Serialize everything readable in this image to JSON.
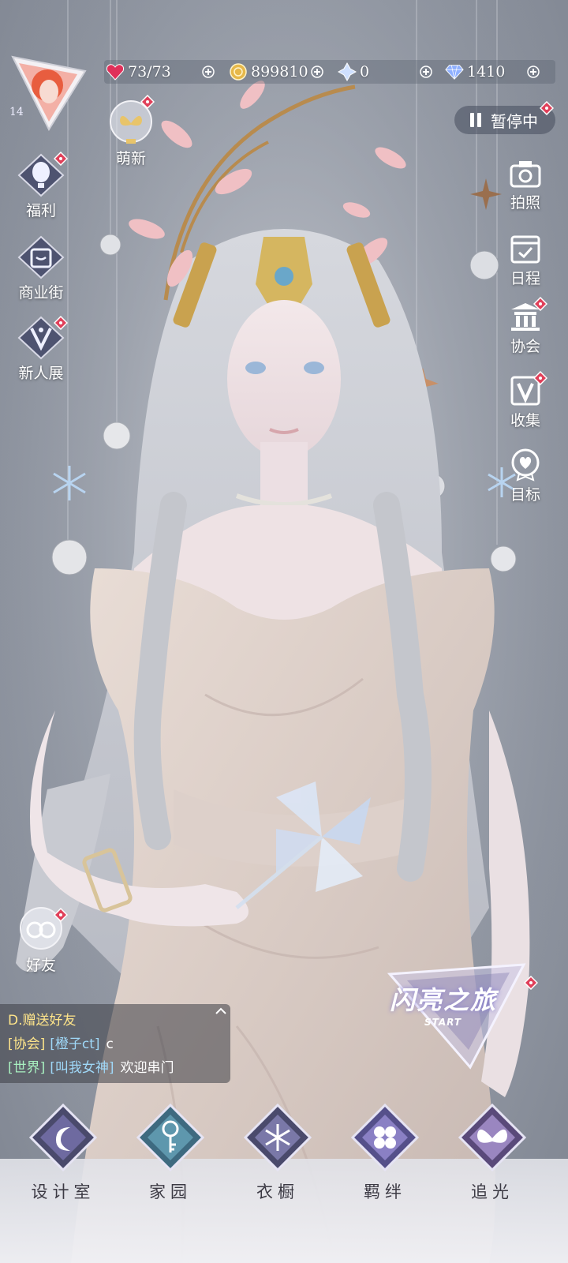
{
  "resources": [
    {
      "name": "stamina-icon",
      "value": "73/73",
      "color": "#e0305a"
    },
    {
      "name": "gold-coin-icon",
      "value": "899810",
      "color": "#e6b84a"
    },
    {
      "name": "crystal-icon",
      "value": "0",
      "color": "#cfe0ff"
    },
    {
      "name": "diamond-icon",
      "value": "1410",
      "color": "#8fb0ff"
    }
  ],
  "player": {
    "level": "14"
  },
  "left_menu": [
    {
      "label": "萌新",
      "icon": "butterfly-icon"
    },
    {
      "label": "福利",
      "icon": "balloon-icon"
    },
    {
      "label": "商业街",
      "icon": "shopping-bag-icon"
    },
    {
      "label": "新人展",
      "icon": "exhibition-icon"
    },
    {
      "label": "好友",
      "icon": "friends-icon"
    }
  ],
  "right_menu": [
    {
      "label": "拍照",
      "icon": "camera-icon"
    },
    {
      "label": "日程",
      "icon": "calendar-icon"
    },
    {
      "label": "协会",
      "icon": "guild-icon"
    },
    {
      "label": "收集",
      "icon": "collection-icon"
    },
    {
      "label": "目标",
      "icon": "goal-icon"
    }
  ],
  "pause": {
    "label": "暂停中"
  },
  "chat": [
    {
      "tag": "",
      "user": "",
      "message": "D.赠送好友"
    },
    {
      "tag": "[协会]",
      "user": "[橙子ct]",
      "message": "c"
    },
    {
      "tag": "[世界]",
      "user": "[叫我女神]",
      "message": "欢迎串门"
    }
  ],
  "journey": {
    "title": "闪亮之旅",
    "subtitle": "START"
  },
  "bottom_nav": [
    {
      "label": "设计室",
      "icon": "moon-icon"
    },
    {
      "label": "家园",
      "icon": "key-icon"
    },
    {
      "label": "衣橱",
      "icon": "snowflake-icon"
    },
    {
      "label": "羁绊",
      "icon": "clover-icon"
    },
    {
      "label": "追光",
      "icon": "butterfly-wing-icon"
    }
  ],
  "colors": {
    "badge": "#e0405a",
    "accent": "#b9a6ff"
  }
}
